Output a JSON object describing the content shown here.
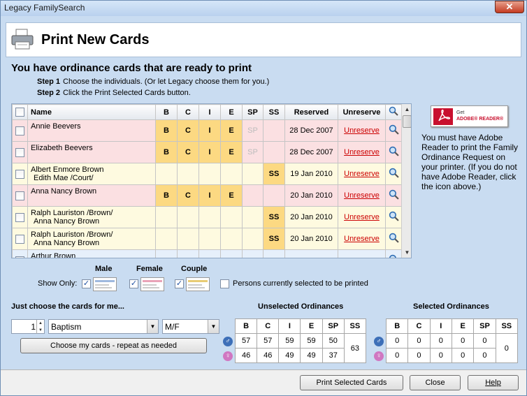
{
  "window": {
    "title": "Legacy FamilySearch",
    "close_glyph": "✕"
  },
  "header": {
    "title": "Print New Cards",
    "icon": "printer-icon"
  },
  "intro": {
    "heading": "You have ordinance cards that are ready to print",
    "step1_label": "Step 1",
    "step1_text": "Choose the individuals.  (Or let Legacy choose them for you.)",
    "step2_label": "Step 2",
    "step2_text": "Click the Print Selected Cards button."
  },
  "cards_table": {
    "columns": {
      "name": "Name",
      "b": "B",
      "c": "C",
      "i": "I",
      "e": "E",
      "sp": "SP",
      "ss": "SS",
      "reserved": "Reserved",
      "unreserve": "Unreserve"
    },
    "rows": [
      {
        "name1": "Annie Beevers",
        "name2": "",
        "b": "B",
        "c": "C",
        "i": "I",
        "e": "E",
        "sp": "SP",
        "ss": "",
        "reserved": "28 Dec 2007",
        "unreserve": "Unreserve",
        "color": "pink"
      },
      {
        "name1": "Elizabeth Beevers",
        "name2": "",
        "b": "B",
        "c": "C",
        "i": "I",
        "e": "E",
        "sp": "SP",
        "ss": "",
        "reserved": "28 Dec 2007",
        "unreserve": "Unreserve",
        "color": "pink"
      },
      {
        "name1": "Albert Enmore Brown",
        "name2": "Edith Mae /Court/",
        "b": "",
        "c": "",
        "i": "",
        "e": "",
        "sp": "",
        "ss": "SS",
        "reserved": "19 Jan 2010",
        "unreserve": "Unreserve",
        "color": "yel"
      },
      {
        "name1": "Anna Nancy Brown",
        "name2": "",
        "b": "B",
        "c": "C",
        "i": "I",
        "e": "E",
        "sp": "",
        "ss": "",
        "reserved": "20 Jan 2010",
        "unreserve": "Unreserve",
        "color": "pink"
      },
      {
        "name1": "Ralph Lauriston /Brown/",
        "name2": "Anna Nancy Brown",
        "b": "",
        "c": "",
        "i": "",
        "e": "",
        "sp": "",
        "ss": "SS",
        "reserved": "20 Jan 2010",
        "unreserve": "Unreserve",
        "color": "yel"
      },
      {
        "name1": "Ralph Lauriston /Brown/",
        "name2": "Anna Nancy Brown",
        "b": "",
        "c": "",
        "i": "",
        "e": "",
        "sp": "",
        "ss": "SS",
        "reserved": "20 Jan 2010",
        "unreserve": "Unreserve",
        "color": "yel"
      },
      {
        "name1": "Arthur Brown",
        "name2": "",
        "b": "",
        "c": "",
        "i": "",
        "e": "",
        "sp": "",
        "ss": "",
        "reserved": "",
        "unreserve": "",
        "color": "blue"
      }
    ]
  },
  "adobe": {
    "get": "Get",
    "reader": "ADOBE® READER®",
    "note": "You must have Adobe Reader to print the Family Ordinance Request on your printer.  (If you do not have Adobe Reader, click the icon above.)"
  },
  "filters": {
    "show_only": "Show Only:",
    "male": "Male",
    "female": "Female",
    "couple": "Couple",
    "persons_selected": "Persons currently selected to be printed",
    "check": "✓"
  },
  "choose": {
    "heading": "Just choose the cards for me...",
    "count": "1",
    "ordinance": "Baptism",
    "gender": "M/F",
    "button": "Choose my cards - repeat as needed"
  },
  "unselected": {
    "heading": "Unselected Ordinances",
    "cols": [
      "B",
      "C",
      "I",
      "E",
      "SP",
      "SS"
    ],
    "male": [
      "57",
      "57",
      "59",
      "59",
      "50"
    ],
    "female": [
      "46",
      "46",
      "49",
      "49",
      "37"
    ],
    "ss": "63"
  },
  "selected": {
    "heading": "Selected Ordinances",
    "cols": [
      "B",
      "C",
      "I",
      "E",
      "SP",
      "SS"
    ],
    "male": [
      "0",
      "0",
      "0",
      "0",
      "0"
    ],
    "female": [
      "0",
      "0",
      "0",
      "0",
      "0"
    ],
    "ss": "0"
  },
  "footer": {
    "print": "Print Selected Cards",
    "close": "Close",
    "help": "Help"
  }
}
